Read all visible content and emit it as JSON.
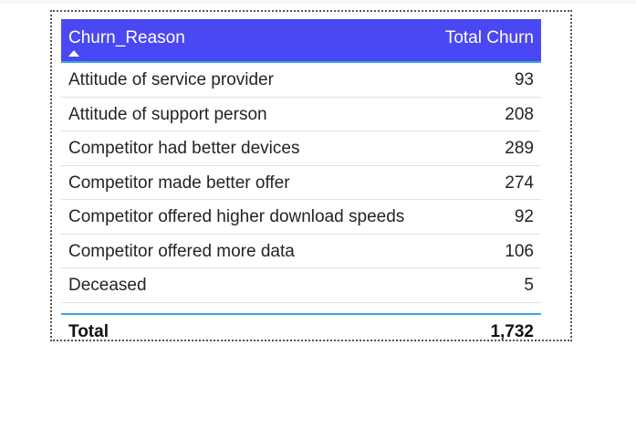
{
  "table": {
    "columns": [
      "Churn_Reason",
      "Total Churn"
    ],
    "sort_icon": "sort-ascending-icon",
    "header_color": "#4a48f2",
    "accent_line_color": "#38a6e0",
    "rows": [
      {
        "reason": "Attitude of service provider",
        "total": "93"
      },
      {
        "reason": "Attitude of support person",
        "total": "208"
      },
      {
        "reason": "Competitor had better devices",
        "total": "289"
      },
      {
        "reason": "Competitor made better offer",
        "total": "274"
      },
      {
        "reason": "Competitor offered higher download speeds",
        "total": "92"
      },
      {
        "reason": "Competitor offered more data",
        "total": "106"
      },
      {
        "reason": "Deceased",
        "total": "5"
      }
    ],
    "total_label": "Total",
    "total_value": "1,732"
  }
}
